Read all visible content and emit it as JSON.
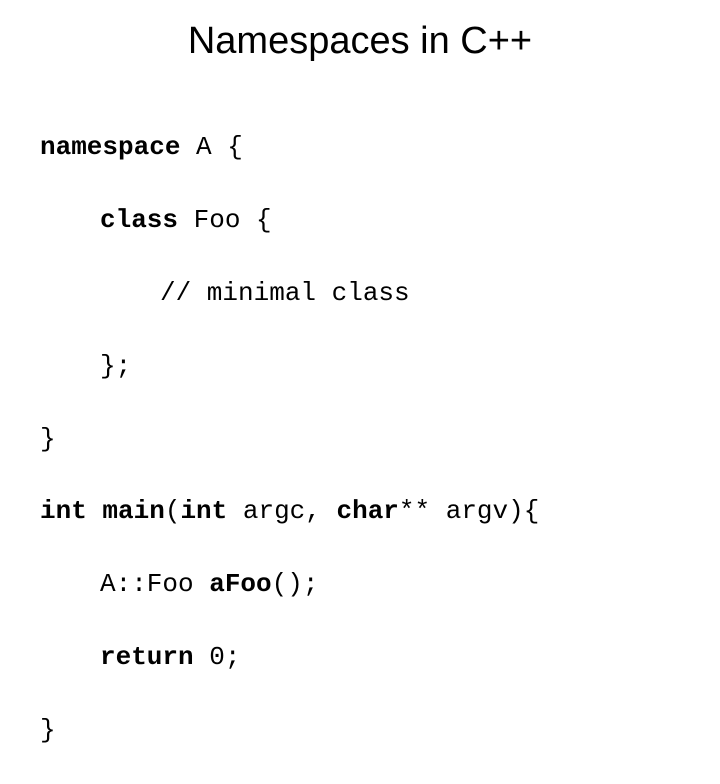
{
  "title": "Namespaces in C++",
  "code": {
    "line1": {
      "kw": "namespace",
      "rest": " A {"
    },
    "line2": {
      "kw": "class",
      "rest": " Foo {"
    },
    "line3": "// minimal class",
    "line4": "};",
    "line5": "}",
    "line6": {
      "kw1": "int",
      "mid1": " ",
      "kw2": "main",
      "mid2": "(",
      "kw3": "int",
      "mid3": " argc, ",
      "kw4": "char",
      "rest": "** argv){"
    },
    "line7": {
      "pre": "A::Foo ",
      "kw": "aFoo",
      "rest": "();"
    },
    "line8": {
      "kw": "return",
      "rest": " 0;"
    },
    "line9": "}"
  }
}
